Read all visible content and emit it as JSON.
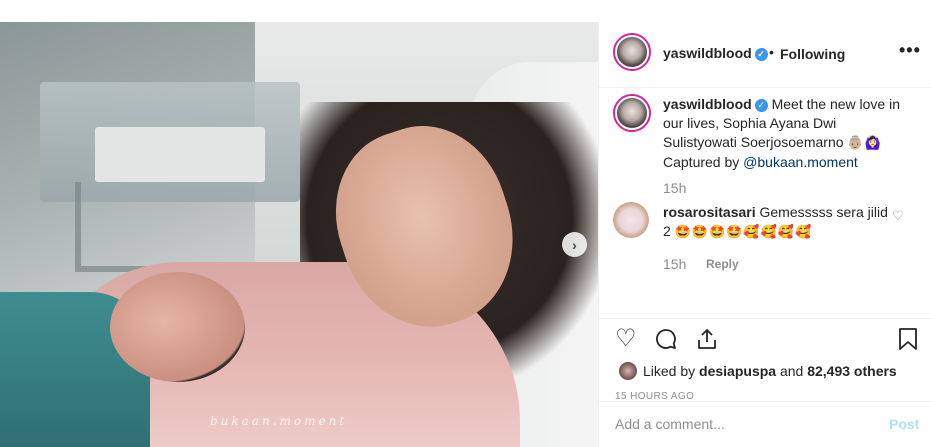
{
  "photo": {
    "watermark": "bukaan.moment"
  },
  "header": {
    "username": "yaswildblood",
    "separator": "•",
    "follow_state": "Following",
    "more": "•••"
  },
  "caption": {
    "username": "yaswildblood",
    "text": "Meet the new love in our lives, Sophia Ayana Dwi Sulistyowati Soerjosoemarno",
    "emojis": "👵🏼🙆🏻‍♀️",
    "captured_prefix": "Captured by",
    "mention": "@bukaan.moment",
    "time": "15h"
  },
  "comment": {
    "username": "rosarositasari",
    "text": "Gemesssss sera jilid 2",
    "emojis": "🤩🤩🤩🤩🥰🥰🥰🥰",
    "time": "15h",
    "reply_label": "Reply"
  },
  "actions": {
    "liked_by_prefix": "Liked by",
    "liked_by_user": "desiapuspa",
    "and_word": "and",
    "others_count": "82,493 others",
    "timestamp": "15 HOURS AGO"
  },
  "add_comment": {
    "placeholder": "Add a comment...",
    "post_label": "Post"
  },
  "colors": {
    "verified": "#3897f0",
    "post_disabled": "#b2dffc",
    "mention": "#003569"
  }
}
